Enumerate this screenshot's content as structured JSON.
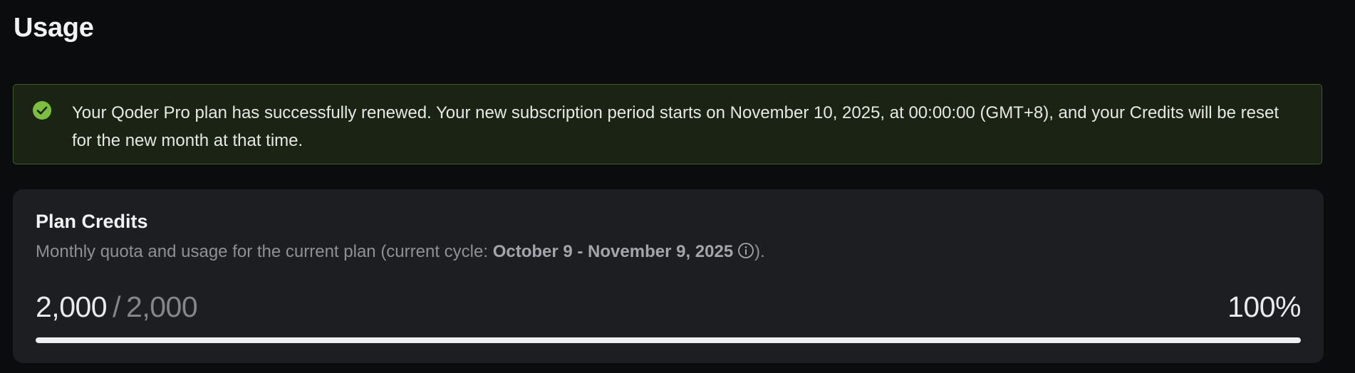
{
  "page": {
    "title": "Usage"
  },
  "banner": {
    "icon": "check-circle-icon",
    "message": "Your Qoder Pro plan has successfully renewed. Your new subscription period starts on November 10, 2025, at 00:00:00 (GMT+8), and your Credits will be reset for the new month at that time.",
    "accent_color": "#7cbf3a"
  },
  "plan_credits": {
    "title": "Plan Credits",
    "subtitle_prefix": "Monthly quota and usage for the current plan (current cycle: ",
    "cycle": "October 9 - November 9, 2025",
    "subtitle_suffix": ").",
    "info_icon": "info-circle-icon",
    "used": "2,000",
    "separator": "/",
    "total": "2,000",
    "percent_label": "100%",
    "progress_fraction": 1.0
  }
}
